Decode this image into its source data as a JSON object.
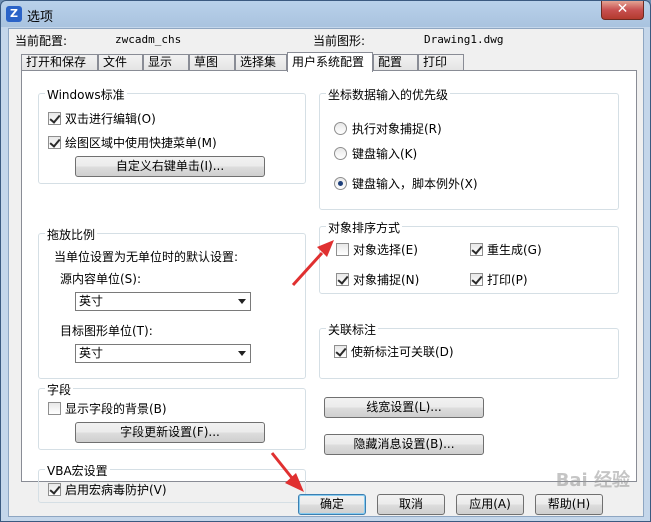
{
  "window": {
    "title": "选项",
    "close_glyph": "✕"
  },
  "header": {
    "current_config_label": "当前配置:",
    "current_config_value": "zwcadm_chs",
    "current_drawing_label": "当前图形:",
    "current_drawing_value": "Drawing1.dwg"
  },
  "tabs": [
    "打开和保存",
    "文件",
    "显示",
    "草图",
    "选择集",
    "用户系统配置",
    "配置",
    "打印"
  ],
  "windows_std": {
    "title": "Windows标准",
    "dblclick_edit": "双击进行编辑(O)",
    "shortcut_menu": "绘图区域中使用快捷菜单(M)",
    "custom_right_click": "自定义右键单击(I)..."
  },
  "scale": {
    "title": "拖放比例",
    "default_label": "当单位设置为无单位时的默认设置:",
    "source_label": "源内容单位(S):",
    "source_value": "英寸",
    "target_label": "目标图形单位(T):",
    "target_value": "英寸"
  },
  "fields": {
    "title": "字段",
    "show_background": "显示字段的背景(B)",
    "update_settings": "字段更新设置(F)..."
  },
  "vba": {
    "title": "VBA宏设置",
    "virus_protect": "启用宏病毒防护(V)"
  },
  "coord": {
    "title": "坐标数据输入的优先级",
    "options": [
      "执行对象捕捉(R)",
      "键盘输入(K)",
      "键盘输入，脚本例外(X)"
    ]
  },
  "sort": {
    "title": "对象排序方式",
    "obj_select": "对象选择(E)",
    "regen": "重生成(G)",
    "obj_snap": "对象捕捉(N)",
    "print": "打印(P)"
  },
  "assoc": {
    "title": "关联标注",
    "new_assoc": "使新标注可关联(D)"
  },
  "buttons": {
    "lineweight": "线宽设置(L)...",
    "hidden_msg": "隐藏消息设置(B)...",
    "ok": "确定",
    "cancel": "取消",
    "apply": "应用(A)",
    "help": "帮助(H)"
  },
  "watermark": "Bai 经验"
}
